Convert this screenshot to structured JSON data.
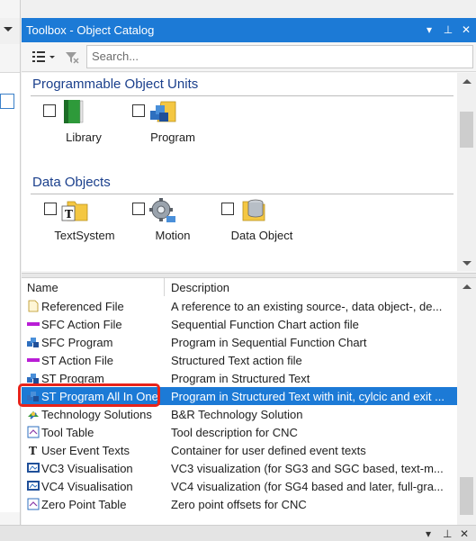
{
  "window": {
    "title": "Toolbox - Object Catalog",
    "title_buttons": {
      "dropdown": "▾",
      "pin": "⊥",
      "close": "✕"
    }
  },
  "toolbar": {
    "view_icon": "list-view-icon",
    "filter_icon": "filter-clear-icon",
    "search_placeholder": "Search..."
  },
  "catalog": {
    "sections": [
      {
        "title": "Programmable Object Units",
        "items": [
          {
            "label": "Library",
            "icon": "library-book-icon",
            "checked": false
          },
          {
            "label": "Program",
            "icon": "program-blocks-icon",
            "checked": false
          }
        ]
      },
      {
        "title": "Data Objects",
        "items": [
          {
            "label": "TextSystem",
            "icon": "text-folder-icon",
            "checked": false
          },
          {
            "label": "Motion",
            "icon": "motion-gear-icon",
            "checked": false
          },
          {
            "label": "Data Object",
            "icon": "data-object-icon",
            "checked": false
          }
        ]
      }
    ]
  },
  "list": {
    "columns": [
      "Name",
      "Description"
    ],
    "rows": [
      {
        "name": "Referenced File",
        "description": "A reference to an existing source-, data object-, de...",
        "icon": "file-icon"
      },
      {
        "name": "SFC Action File",
        "description": "Sequential Function Chart action file",
        "icon": "sfc-action-icon"
      },
      {
        "name": "SFC Program",
        "description": "Program in Sequential Function Chart",
        "icon": "program-icon"
      },
      {
        "name": "ST Action File",
        "description": "Structured Text action file",
        "icon": "st-action-icon"
      },
      {
        "name": "ST Program",
        "description": "Program in Structured Text",
        "icon": "program-icon"
      },
      {
        "name": "ST Program All In One",
        "description": "Program in Structured Text with init, cylcic and exit ...",
        "icon": "program-icon",
        "selected": true
      },
      {
        "name": "Technology Solutions",
        "description": "B&R Technology Solution",
        "icon": "technology-icon"
      },
      {
        "name": "Tool Table",
        "description": "Tool description for CNC",
        "icon": "table-icon"
      },
      {
        "name": "User Event Texts",
        "description": "Container for user defined event texts",
        "icon": "text-t-icon"
      },
      {
        "name": "VC3 Visualisation",
        "description": "VC3 visualization (for SG3 and SGC based, text-m...",
        "icon": "visualisation-icon"
      },
      {
        "name": "VC4 Visualisation",
        "description": "VC4 visualization (for SG4 based and later, full-gra...",
        "icon": "visualisation-icon"
      },
      {
        "name": "Zero Point Table",
        "description": "Zero point offsets for CNC",
        "icon": "table-icon"
      }
    ]
  },
  "colors": {
    "accent": "#1c7ad6",
    "highlight": "#e8231a",
    "section_title": "#1a3f8c"
  }
}
